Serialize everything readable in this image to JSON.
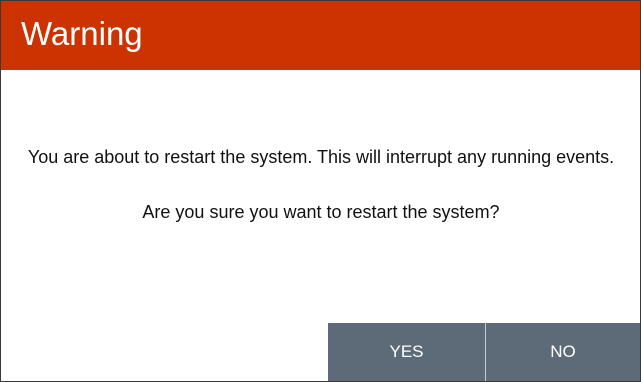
{
  "dialog": {
    "title": "Warning",
    "message_line": "You are about to restart the system. This will interrupt any running events.",
    "question": "Are you sure you want to restart the system?",
    "buttons": {
      "yes_label": "YES",
      "no_label": "NO"
    }
  },
  "colors": {
    "title_bar": "#cc3300",
    "button_bg": "#5d6b78",
    "button_text": "#ffffff"
  }
}
